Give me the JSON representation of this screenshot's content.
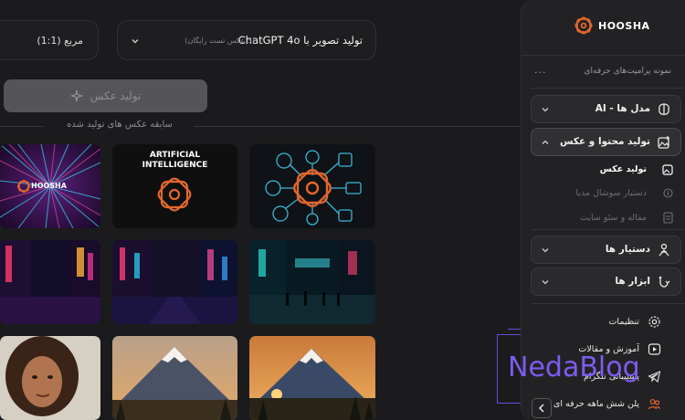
{
  "brand": {
    "name": "HOOSHA",
    "accent": "#e2672d"
  },
  "top_bar": {
    "model_title": "تولید تصویر با ChatGPT 4o",
    "model_sub": "(3 عکس تست رایگان)",
    "ratio_label": "مربع (1:1)"
  },
  "generate_button": {
    "label": "تولید عکس",
    "icon": "sparkle-icon"
  },
  "history": {
    "title": "سابقه عکس های تولید شده",
    "tiles": [
      {
        "kind": "ai-icons",
        "alt": "ai-network-image"
      },
      {
        "kind": "text-logo",
        "line1": "ARTIFICIAL",
        "line2": "INTELLIGENCE"
      },
      {
        "kind": "burst",
        "logo_text": "HOOSHA"
      },
      {
        "kind": "neon-street"
      },
      {
        "kind": "neon-street"
      },
      {
        "kind": "neon-street"
      },
      {
        "kind": "mountain"
      },
      {
        "kind": "mountain"
      },
      {
        "kind": "portrait"
      }
    ]
  },
  "sidebar": {
    "prompt_samples": "نمونه پرامپت‌های حرفه‌ای",
    "more": "...",
    "sections": [
      {
        "label": "مدل ها - AI",
        "icon": "brain-icon",
        "open": false
      },
      {
        "label": "تولید محتوا و عکس",
        "icon": "image-plus-icon",
        "open": true
      },
      {
        "label": "دستیار ها",
        "icon": "assistant-icon",
        "open": false
      },
      {
        "label": "ابزار ها",
        "icon": "tools-icon",
        "open": false
      }
    ],
    "sub_items": [
      {
        "label": "تولید عکس",
        "icon": "image-icon",
        "state": "active"
      },
      {
        "label": "دستیار سوشال مدیا",
        "icon": "hash-icon",
        "state": "dim"
      },
      {
        "label": "مقاله و سئو سایت",
        "icon": "document-icon",
        "state": "dim"
      }
    ],
    "links": [
      {
        "label": "تنظیمات",
        "icon": "gear-icon"
      },
      {
        "label": "آموزش و مقالات",
        "icon": "play-icon"
      },
      {
        "label": "پشتیبانی تلگرام",
        "icon": "telegram-icon"
      },
      {
        "label": "پلن شش ماهه حرفه ای",
        "icon": "users-icon"
      }
    ]
  },
  "watermark": {
    "text": "NedaBlog",
    "color": "#7d5cf0"
  }
}
